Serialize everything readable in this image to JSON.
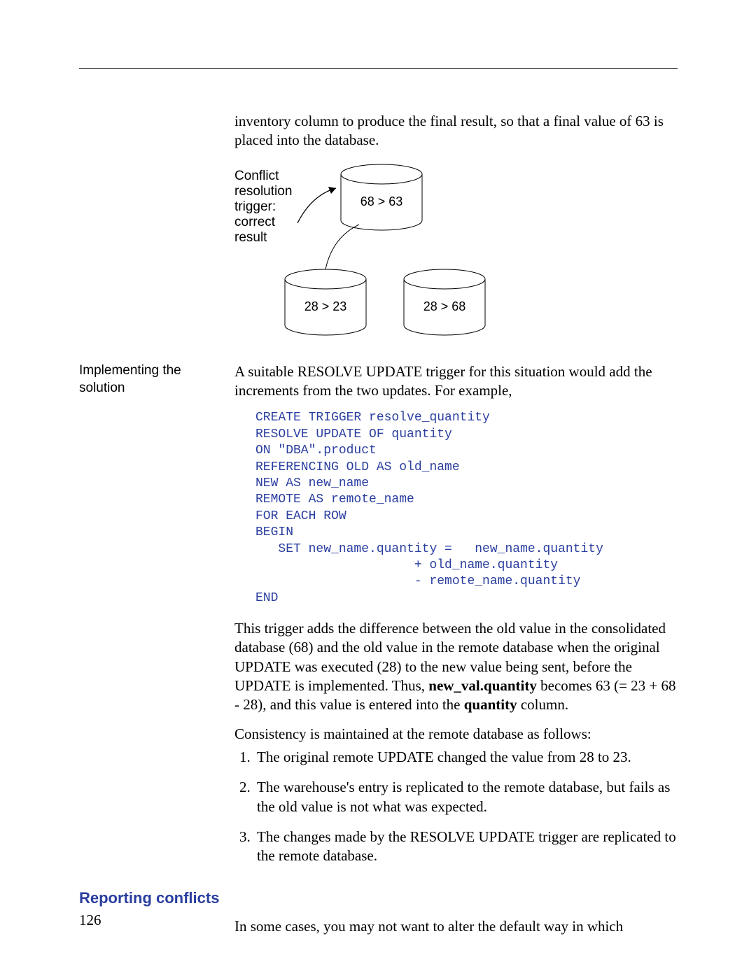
{
  "intro": "inventory column to produce the final result, so that a final value of 63 is placed into the database.",
  "figure": {
    "annotation_lines": [
      "Conflict",
      "resolution",
      "trigger:",
      "correct",
      "result"
    ],
    "top_label": "68 > 63",
    "bl_label": "28 > 23",
    "br_label": "28 > 68"
  },
  "section1": {
    "side": "Implementing the solution",
    "para": "A suitable RESOLVE UPDATE trigger for this situation would add the increments from the two updates. For example,",
    "code": "CREATE TRIGGER resolve_quantity\nRESOLVE UPDATE OF quantity\nON \"DBA\".product\nREFERENCING OLD AS old_name\nNEW AS new_name\nREMOTE AS remote_name\nFOR EACH ROW\nBEGIN\n   SET new_name.quantity =   new_name.quantity\n                     + old_name.quantity\n                     - remote_name.quantity\nEND",
    "para2_parts": {
      "a": "This trigger adds the difference between the old value in the consolidated database (68) and the old value in the remote database when the original UPDATE was executed (28) to the new value being sent, before the UPDATE is implemented. Thus, ",
      "b": "new_val.quantity",
      "c": " becomes 63 (= 23 + 68 - 28), and this value is entered into the ",
      "d": "quantity",
      "e": " column."
    },
    "para3": "Consistency is maintained at the remote database as follows:",
    "list": [
      "The original remote UPDATE changed the value from 28 to 23.",
      "The warehouse's entry is replicated to the remote database, but fails as the old value is not what was expected.",
      "The changes made by the RESOLVE UPDATE trigger are replicated to the remote database."
    ]
  },
  "subhead": "Reporting conflicts",
  "closing": "In some cases, you may not want to alter the default way in which",
  "pagenum": "126"
}
